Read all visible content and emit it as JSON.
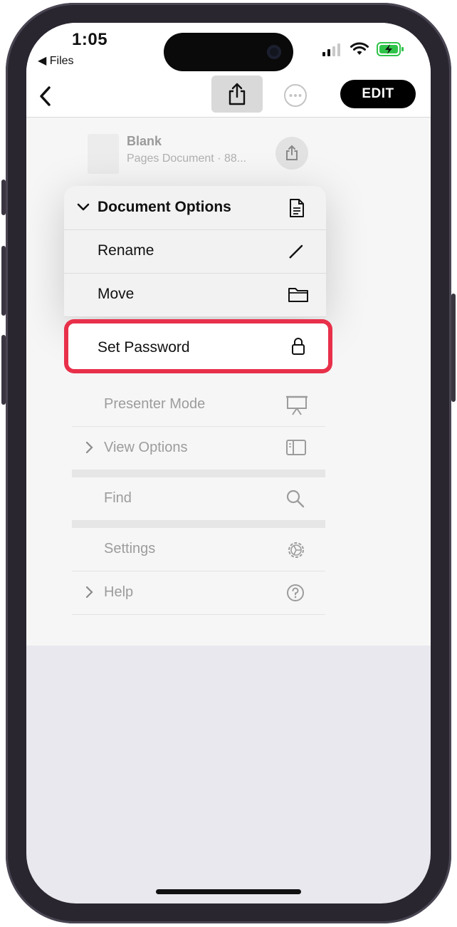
{
  "status": {
    "time": "1:05",
    "back_app": "◀ Files"
  },
  "toolbar": {
    "edit_label": "EDIT"
  },
  "document": {
    "name": "Blank",
    "meta": "Pages Document · 88..."
  },
  "popup": {
    "header": "Document Options",
    "items": [
      {
        "label": "Rename",
        "icon": "pencil-icon"
      },
      {
        "label": "Move",
        "icon": "folder-icon"
      },
      {
        "label": "Set Password",
        "icon": "lock-icon"
      }
    ]
  },
  "menu": {
    "items": [
      {
        "label": "Presenter Mode",
        "icon": "presenter-icon"
      },
      {
        "label": "View Options",
        "icon": "sidebar-icon"
      },
      {
        "label": "Find",
        "icon": "search-icon"
      },
      {
        "label": "Settings",
        "icon": "gear-icon"
      },
      {
        "label": "Help",
        "icon": "help-icon"
      }
    ]
  },
  "colors": {
    "highlight": "#e8304a",
    "edit_button": "#000000"
  }
}
